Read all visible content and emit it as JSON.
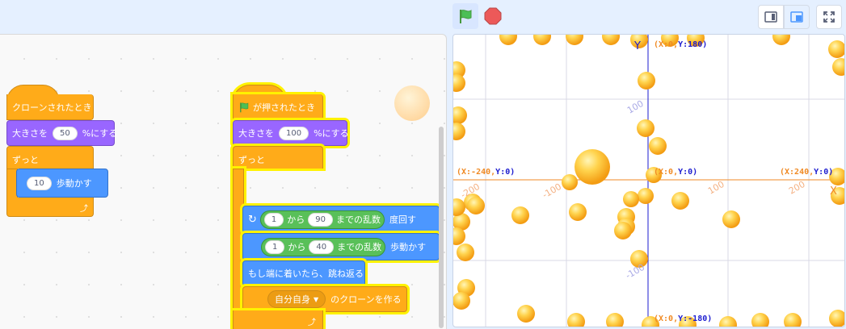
{
  "header": {
    "flag_icon": "green-flag-icon",
    "stop_icon": "stop-icon",
    "small_stage_icon": "small-stage-icon",
    "large_stage_icon": "large-stage-icon",
    "fullscreen_icon": "fullscreen-icon"
  },
  "script1": {
    "hat": "クローンされたとき",
    "set_size_prefix": "大きさを",
    "set_size_value": "50",
    "set_size_suffix": "%にする",
    "forever": "ずっと",
    "move_value": "10",
    "move_suffix": "歩動かす"
  },
  "script2": {
    "hat": "が押されたとき",
    "set_size_prefix": "大きさを",
    "set_size_value": "100",
    "set_size_suffix": "%にする",
    "forever": "ずっと",
    "turn_from": "1",
    "turn_kara": "から",
    "turn_to": "90",
    "turn_random": "までの乱数",
    "turn_suffix": "度回す",
    "move_from": "1",
    "move_kara": "から",
    "move_to": "40",
    "move_random": "までの乱数",
    "move_suffix": "歩動かす",
    "bounce": "もし端に着いたら、跳ね返る",
    "clone_target": "自分自身",
    "clone_suffix": "のクローンを作る"
  },
  "stage": {
    "y_axis_label": "Y",
    "x_axis_label": "X",
    "top_label_a": "(X:0,",
    "top_label_b": "Y:180)",
    "bottom_label_a": "(X:0,",
    "bottom_label_b": "Y:-180)",
    "left_label_a": "(X:-240,",
    "left_label_b": "Y:0)",
    "right_label_a": "(X:240,",
    "right_label_b": "Y:0)",
    "center_label_a": "(X:0,",
    "center_label_b": "Y:0)",
    "tick_x_pos100": "100",
    "tick_x_pos200": "200",
    "tick_x_neg100": "-100",
    "tick_x_neg200": "-200",
    "tick_y_pos100": "100",
    "tick_y_neg100": "-100"
  }
}
